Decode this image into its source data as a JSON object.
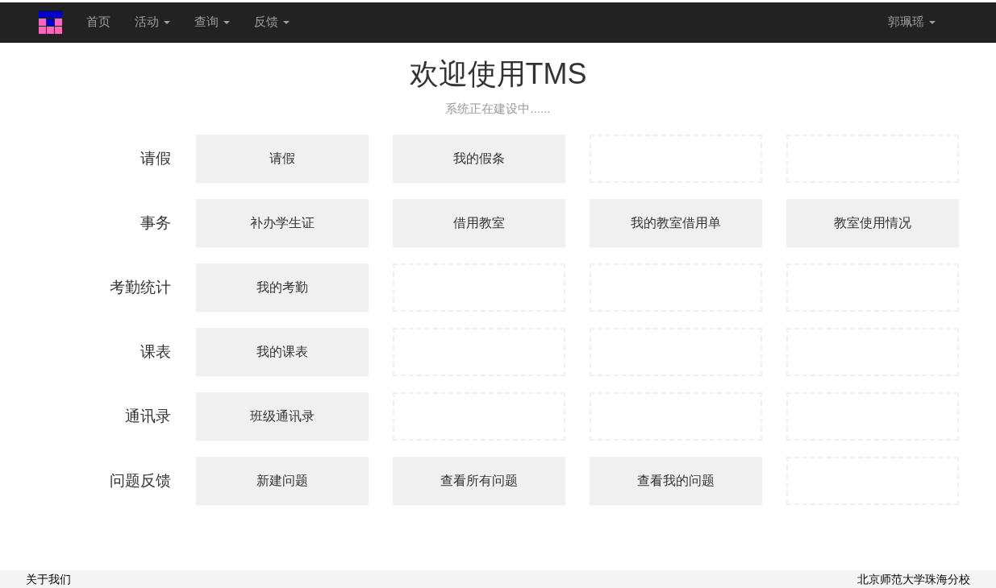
{
  "navbar": {
    "items": [
      {
        "label": "首页",
        "dropdown": false
      },
      {
        "label": "活动",
        "dropdown": true
      },
      {
        "label": "查询",
        "dropdown": true
      },
      {
        "label": "反馈",
        "dropdown": true
      }
    ],
    "user": {
      "label": "郭珮瑶",
      "dropdown": true
    }
  },
  "heading": "欢迎使用TMS",
  "subtitle": "系统正在建设中......",
  "rows": [
    {
      "label": "请假",
      "tiles": [
        {
          "kind": "link",
          "label": "请假"
        },
        {
          "kind": "link",
          "label": "我的假条"
        },
        {
          "kind": "empty"
        },
        {
          "kind": "empty"
        }
      ]
    },
    {
      "label": "事务",
      "tiles": [
        {
          "kind": "link",
          "label": "补办学生证"
        },
        {
          "kind": "link",
          "label": "借用教室"
        },
        {
          "kind": "link",
          "label": "我的教室借用单"
        },
        {
          "kind": "link",
          "label": "教室使用情况"
        }
      ]
    },
    {
      "label": "考勤统计",
      "tiles": [
        {
          "kind": "link",
          "label": "我的考勤"
        },
        {
          "kind": "empty"
        },
        {
          "kind": "empty"
        },
        {
          "kind": "empty"
        }
      ]
    },
    {
      "label": "课表",
      "tiles": [
        {
          "kind": "link",
          "label": "我的课表"
        },
        {
          "kind": "empty"
        },
        {
          "kind": "empty"
        },
        {
          "kind": "empty"
        }
      ]
    },
    {
      "label": "通讯录",
      "tiles": [
        {
          "kind": "link",
          "label": "班级通讯录"
        },
        {
          "kind": "empty"
        },
        {
          "kind": "empty"
        },
        {
          "kind": "empty"
        }
      ]
    },
    {
      "label": "问题反馈",
      "tiles": [
        {
          "kind": "link",
          "label": "新建问题"
        },
        {
          "kind": "link",
          "label": "查看所有问题"
        },
        {
          "kind": "link",
          "label": "查看我的问题"
        },
        {
          "kind": "empty"
        }
      ]
    }
  ],
  "footer": {
    "left": "关于我们",
    "right": "北京师范大学珠海分校"
  }
}
